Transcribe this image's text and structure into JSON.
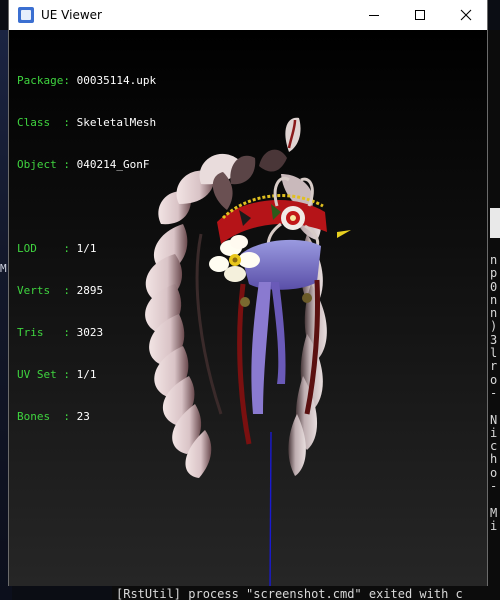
{
  "window": {
    "title": "UE Viewer",
    "icons": {
      "app": "ue-viewer-icon",
      "minimize": "minimize-icon",
      "maximize": "maximize-icon",
      "close": "close-icon"
    }
  },
  "info": {
    "package": {
      "label": "Package:",
      "value": "00035114.upk"
    },
    "class": {
      "label": "Class  :",
      "value": "SkeletalMesh"
    },
    "object": {
      "label": "Object :",
      "value": "040214_GonF"
    },
    "lod": {
      "label": "LOD    :",
      "value": "1/1"
    },
    "verts": {
      "label": "Verts  :",
      "value": "2895"
    },
    "tris": {
      "label": "Tris   :",
      "value": "3023"
    },
    "uvset": {
      "label": "UV Set :",
      "value": "1/1"
    },
    "bones": {
      "label": "Bones  :",
      "value": "23"
    },
    "label_color": "#3fd43f",
    "value_color": "#ffffff"
  },
  "background": {
    "left_glyph": "M",
    "right_column": [
      "n",
      "p",
      "0",
      "n",
      "n",
      ")",
      "3",
      "l",
      "r",
      "o",
      "-",
      "",
      "N",
      "i",
      "c",
      "h",
      "o",
      "-",
      "",
      "M",
      "i"
    ],
    "bottom_line": "[RstUtil] process \"screenshot.cmd\" exited with c"
  },
  "model": {
    "name": "040214_GonF",
    "icon": "feather-headdress-model"
  }
}
